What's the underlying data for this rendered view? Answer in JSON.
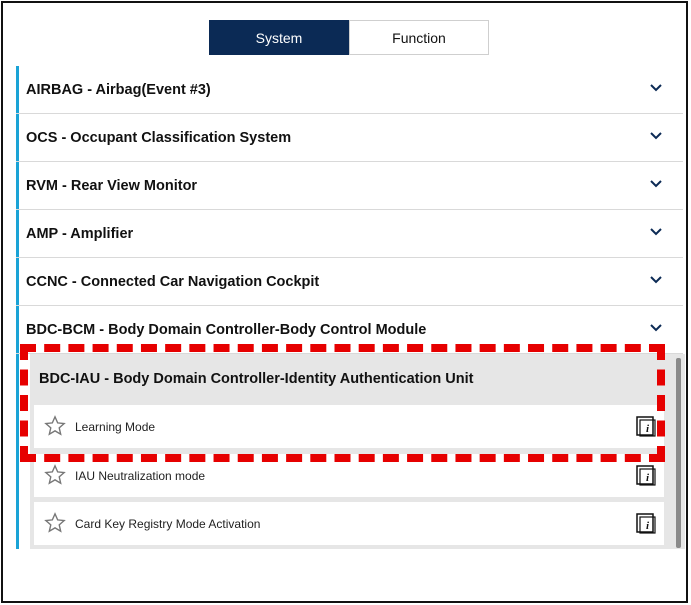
{
  "tabs": {
    "system": "System",
    "function": "Function"
  },
  "systems": [
    {
      "label": "AIRBAG - Airbag(Event #3)"
    },
    {
      "label": "OCS - Occupant Classification System"
    },
    {
      "label": "RVM - Rear View Monitor"
    },
    {
      "label": "AMP - Amplifier"
    },
    {
      "label": "CCNC - Connected Car Navigation Cockpit"
    },
    {
      "label": "BDC-BCM - Body Domain Controller-Body Control Module"
    }
  ],
  "expanded_group": {
    "title": "BDC-IAU - Body Domain Controller-Identity Authentication Unit",
    "items": [
      {
        "label": "Learning Mode"
      },
      {
        "label": "IAU Neutralization mode"
      },
      {
        "label": "Card Key Registry Mode Activation"
      }
    ]
  },
  "colors": {
    "tab_active": "#0b2a55",
    "accent_bar": "#1aa3d6",
    "highlight": "#e60000"
  }
}
